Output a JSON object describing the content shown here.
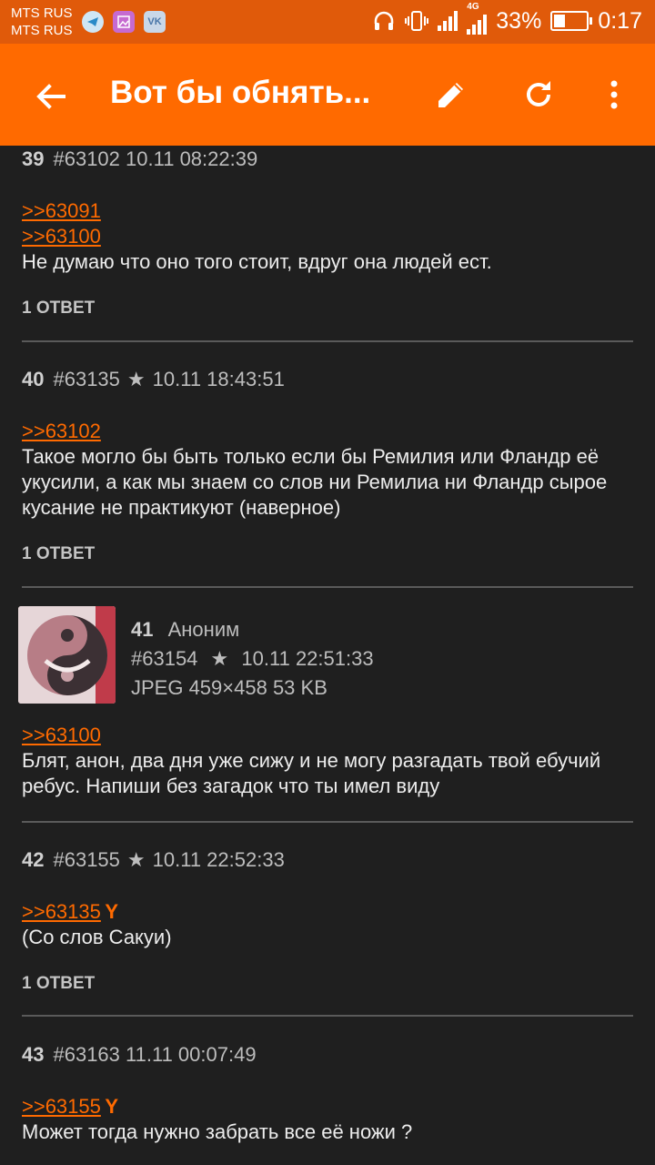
{
  "status_bar": {
    "carrier1": "MTS RUS",
    "carrier2": "MTS RUS",
    "network": "4G",
    "battery": "33%",
    "battery_level": 0.33,
    "time": "0:17",
    "icons": [
      "telegram-icon",
      "gallery-icon",
      "vk-icon",
      "headphones-icon",
      "vibrate-icon",
      "signal-icon",
      "battery-icon"
    ]
  },
  "appbar": {
    "title": "Вот бы обнять...",
    "color": "#ff6a00",
    "icons": [
      "back-arrow-icon",
      "edit-icon",
      "refresh-icon",
      "more-vert-icon"
    ]
  },
  "posts": [
    {
      "num": "39",
      "id": "#63102",
      "star": false,
      "date": "10.11 08:22:39",
      "refs": [
        ">>63091",
        ">>63100"
      ],
      "text": "Не думаю что оно того стоит, вдруг она людей ест.",
      "replies": "1 ОТВЕТ"
    },
    {
      "num": "40",
      "id": "#63135",
      "star": true,
      "date": "10.11 18:43:51",
      "refs": [
        ">>63102"
      ],
      "text": "Такое могло бы быть только если бы Ремилия или Фландр её укусили, а как мы знаем со слов ни Ремилиа ни Фландр сырое кусание не практикуют (наверное)",
      "replies": "1 ОТВЕТ"
    },
    {
      "num": "41",
      "name": "Аноним",
      "id": "#63154",
      "star": true,
      "date": "10.11 22:51:33",
      "file": "JPEG 459×458 53 KB",
      "refs": [
        ">>63100"
      ],
      "text": "Блят, анон, два дня уже сижу и не могу разгадать твой ебучий ребус. Напиши без загадок что ты имел виду"
    },
    {
      "num": "42",
      "id": "#63155",
      "star": true,
      "date": "10.11 22:52:33",
      "refs": [
        ">>63135"
      ],
      "you": "Y",
      "text": "(Со слов Сакуи)",
      "replies": "1 ОТВЕТ"
    },
    {
      "num": "43",
      "id": "#63163",
      "star": false,
      "date": "11.11 00:07:49",
      "refs": [
        ">>63155"
      ],
      "you": "Y",
      "text": "Может тогда нужно забрать все её ножи ?"
    }
  ]
}
